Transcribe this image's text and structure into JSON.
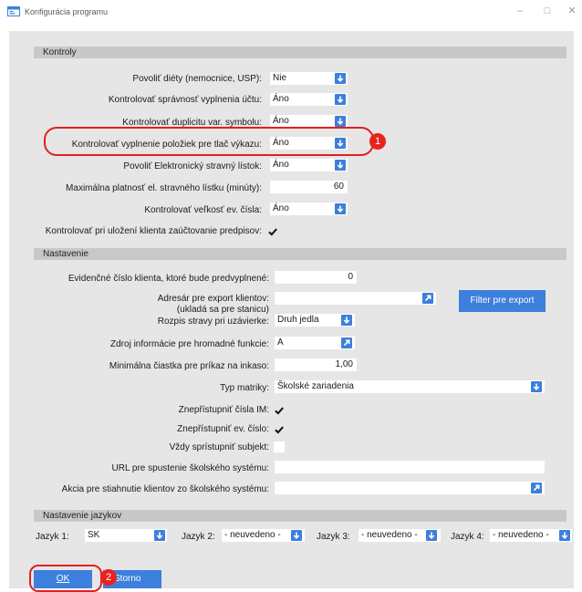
{
  "window": {
    "title": "Konfigurácia programu",
    "minimize": "–",
    "maximize": "□",
    "close": "✕"
  },
  "kontroly": {
    "header": "Kontroly",
    "diety_label": "Povoliť diéty (nemocnice, USP):",
    "diety_value": "Nie",
    "spravnost_label": "Kontrolovať správnosť vyplnenia účtu:",
    "spravnost_value": "Áno",
    "duplicita_label": "Kontrolovať duplicitu var. symbolu:",
    "duplicita_value": "Áno",
    "vyplnenie_label": "Kontrolovať vyplnenie položiek pre tlač výkazu:",
    "vyplnenie_value": "Áno",
    "esl_label": "Povoliť Elektronický stravný lístok:",
    "esl_value": "Áno",
    "platnost_label": "Maximálna platnosť el. stravného lístku (minúty):",
    "platnost_value": "60",
    "velkost_label": "Kontrolovať veľkosť ev. čísla:",
    "velkost_value": "Áno",
    "zauctovanie_label": "Kontrolovať pri uložení klienta zaúčtovanie predpisov:",
    "zauctovanie_checked": true
  },
  "nastavenie": {
    "header": "Nastavenie",
    "evidencne_label": "Evidenčné číslo klienta, ktoré bude predvyplnené:",
    "evidencne_value": "0",
    "adresar_label_1": "Adresár pre export klientov:",
    "adresar_label_2": "(ukladá sa pre stanicu)",
    "adresar_value": "",
    "filter_button": "Filter pre export",
    "rozpis_label": "Rozpis stravy pri uzávierke:",
    "rozpis_value": "Druh jedla",
    "zdroj_label": "Zdroj informácie pre hromadné funkcie:",
    "zdroj_value": "A",
    "minimalna_label": "Minimálna čiastka pre príkaz na inkaso:",
    "minimalna_value": "1,00",
    "typ_label": "Typ matriky:",
    "typ_value": "Školské zariadenia",
    "im_label": "Znepřístupniť čísla IM:",
    "im_checked": true,
    "ev_label": "Znepřístupniť ev. číslo:",
    "ev_checked": true,
    "subjekt_label": "Vždy sprístupniť subjekt:",
    "subjekt_checked": false,
    "url_label": "URL pre spustenie školského systému:",
    "url_value": "",
    "akcia_label": "Akcia pre stiahnutie klientov zo školského systému:",
    "akcia_value": ""
  },
  "jazyky": {
    "header": "Nastavenie jazykov",
    "jazyk1_label": "Jazyk 1:",
    "jazyk1_value": "SK",
    "jazyk2_label": "Jazyk 2:",
    "jazyk2_value": "- neuvedeno -",
    "jazyk3_label": "Jazyk 3:",
    "jazyk3_value": "- neuvedeno -",
    "jazyk4_label": "Jazyk 4:",
    "jazyk4_value": "- neuvedeno -"
  },
  "footer": {
    "ok_label": "OK",
    "cancel_label": "Storno"
  },
  "callouts": {
    "one": "1",
    "two": "2"
  },
  "colors": {
    "accent": "#3d7fdc",
    "panel": "#e6e6e6",
    "section": "#c8c8c8",
    "callout": "#e8231f"
  }
}
